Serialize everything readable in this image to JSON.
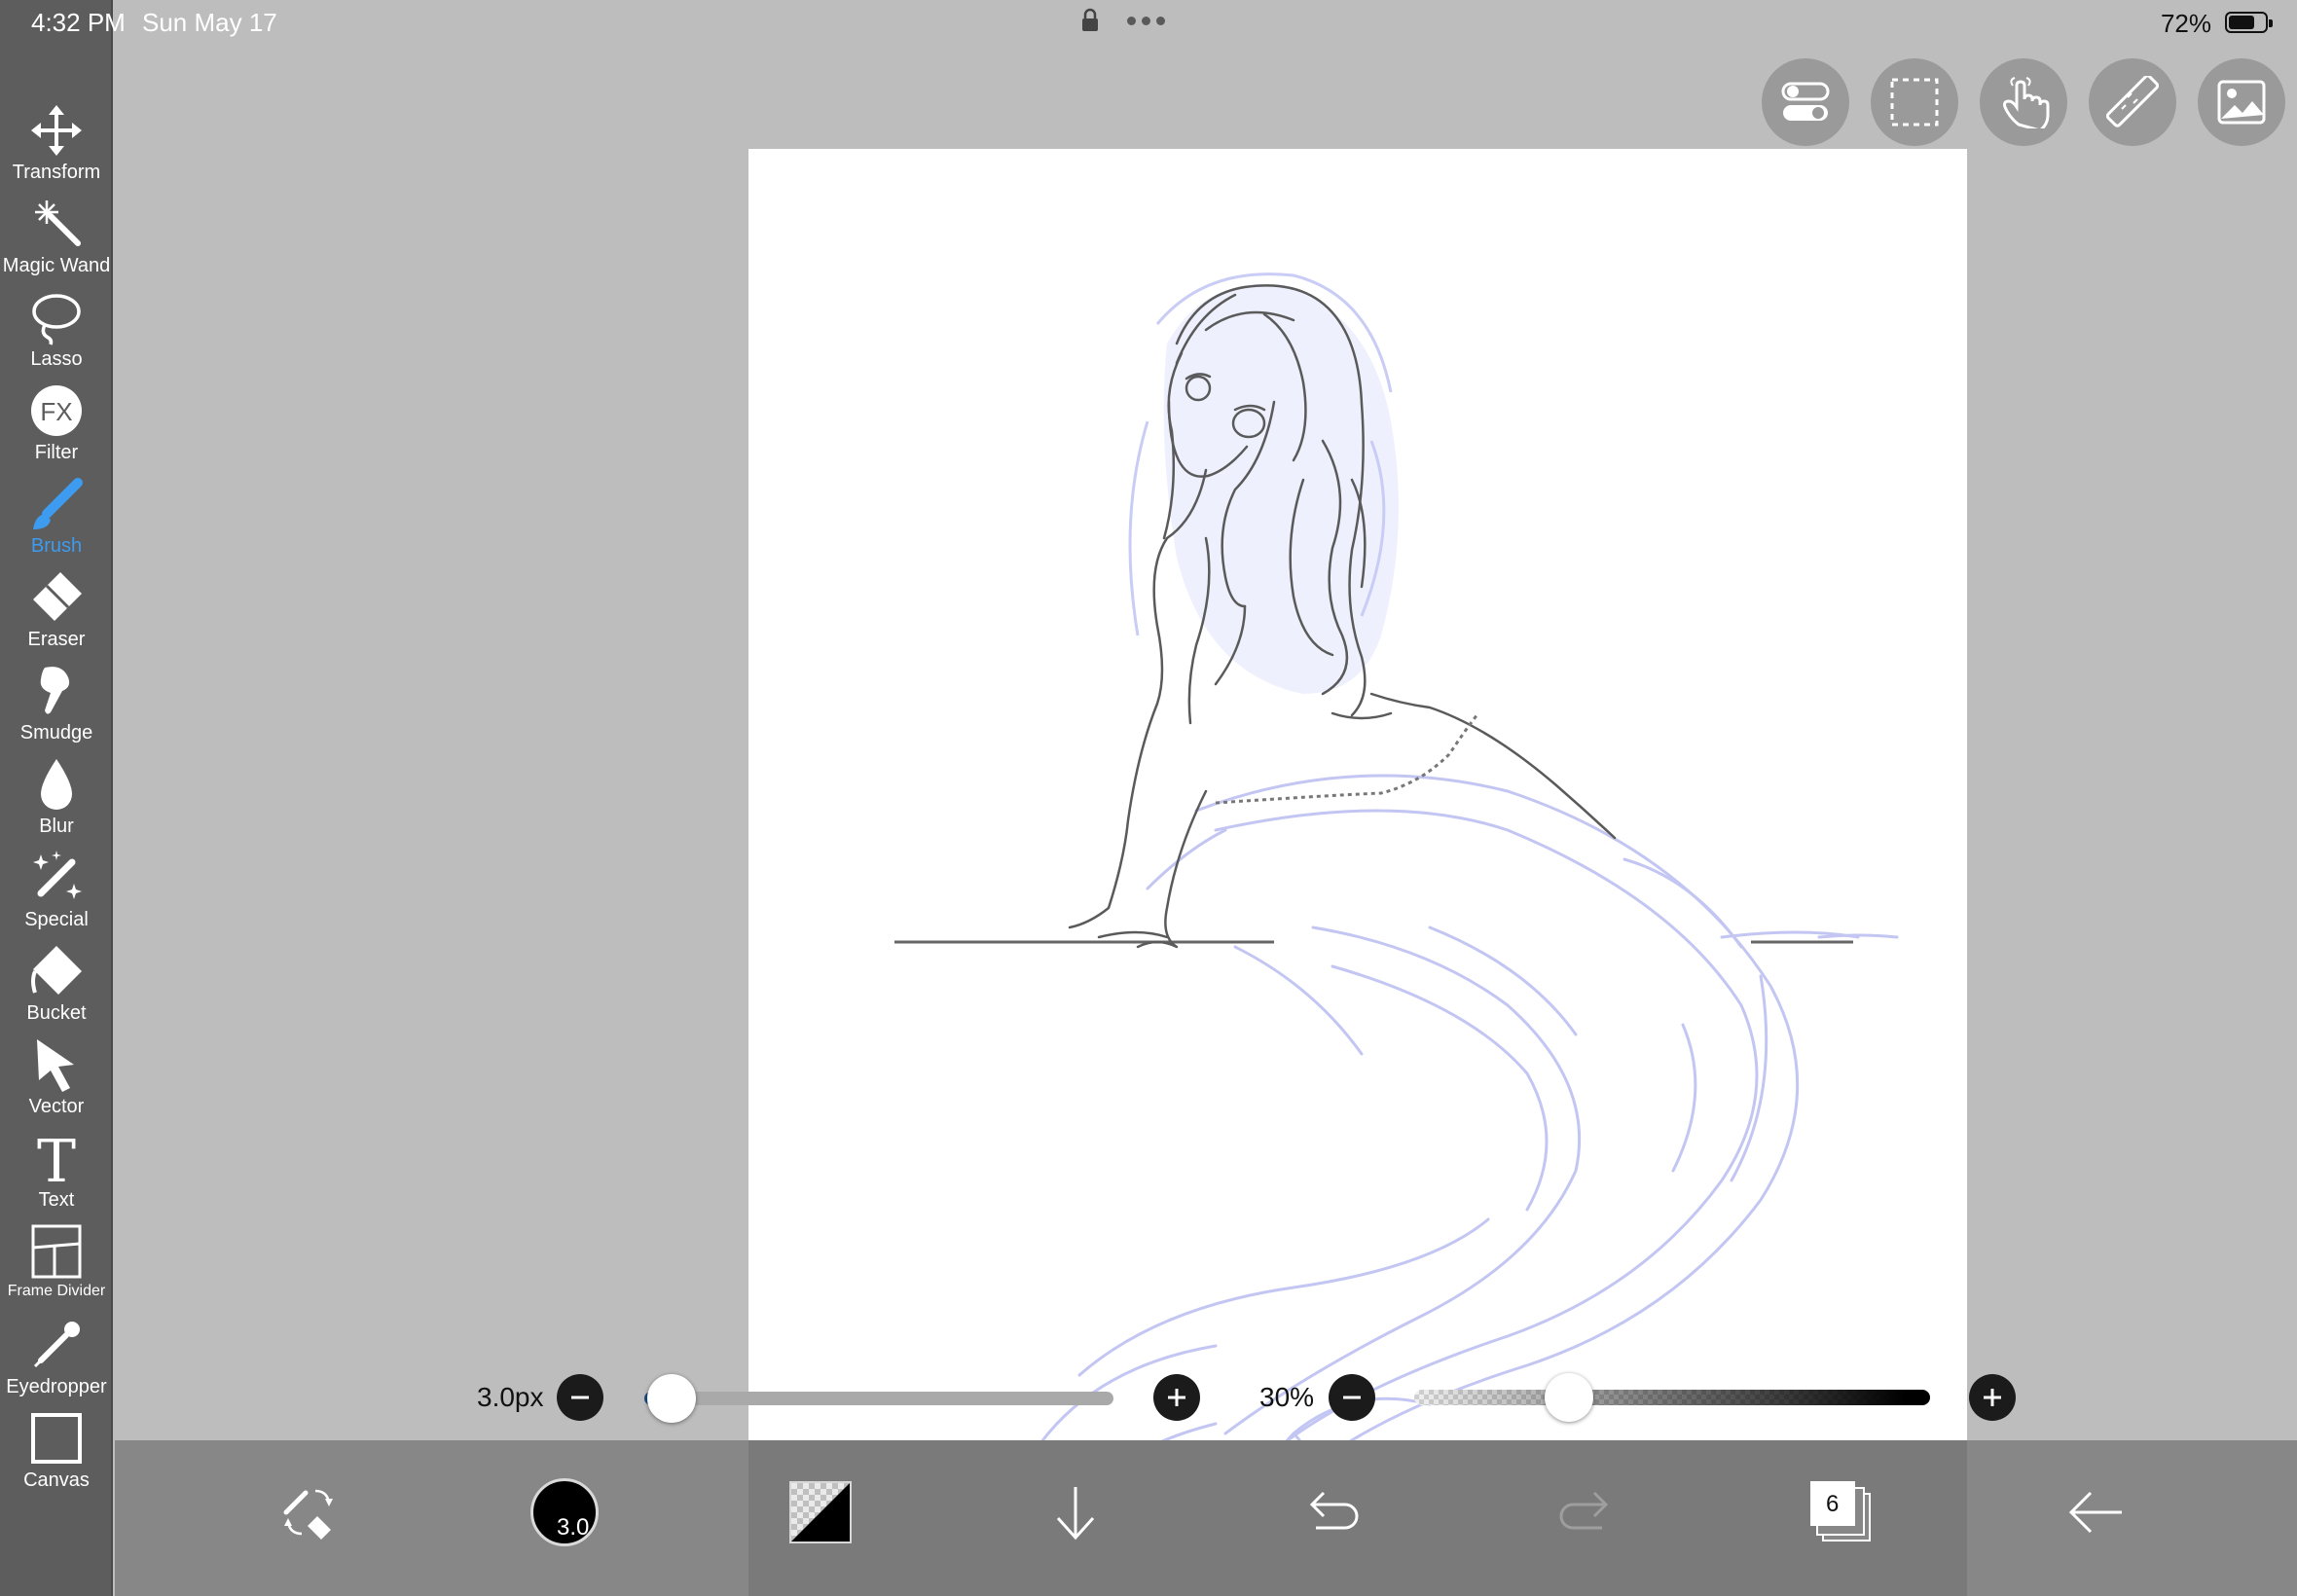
{
  "status_bar": {
    "time": "4:32 PM",
    "date": "Sun May 17",
    "battery_percent": "72%",
    "battery_level": 0.72
  },
  "tools": [
    {
      "id": "transform",
      "label": "Transform",
      "icon": "move-arrows-icon",
      "active": false
    },
    {
      "id": "magic-wand",
      "label": "Magic Wand",
      "icon": "magic-wand-icon",
      "active": false
    },
    {
      "id": "lasso",
      "label": "Lasso",
      "icon": "lasso-icon",
      "active": false
    },
    {
      "id": "filter",
      "label": "Filter",
      "icon": "fx-icon",
      "active": false
    },
    {
      "id": "brush",
      "label": "Brush",
      "icon": "brush-icon",
      "active": true
    },
    {
      "id": "eraser",
      "label": "Eraser",
      "icon": "eraser-icon",
      "active": false
    },
    {
      "id": "smudge",
      "label": "Smudge",
      "icon": "smudge-icon",
      "active": false
    },
    {
      "id": "blur",
      "label": "Blur",
      "icon": "droplet-icon",
      "active": false
    },
    {
      "id": "special",
      "label": "Special",
      "icon": "sparkle-brush-icon",
      "active": false
    },
    {
      "id": "bucket",
      "label": "Bucket",
      "icon": "bucket-icon",
      "active": false
    },
    {
      "id": "vector",
      "label": "Vector",
      "icon": "cursor-arrow-icon",
      "active": false
    },
    {
      "id": "text",
      "label": "Text",
      "icon": "text-t-icon",
      "active": false
    },
    {
      "id": "frame-divider",
      "label": "Frame Divider",
      "icon": "frame-divider-icon",
      "active": false
    },
    {
      "id": "eyedropper",
      "label": "Eyedropper",
      "icon": "eyedropper-icon",
      "active": false
    },
    {
      "id": "canvas",
      "label": "Canvas",
      "icon": "canvas-square-icon",
      "active": false
    }
  ],
  "right_buttons": [
    {
      "id": "toggle",
      "icon": "toggle-switches-icon"
    },
    {
      "id": "selection",
      "icon": "dashed-selection-icon"
    },
    {
      "id": "gesture",
      "icon": "hand-touch-icon"
    },
    {
      "id": "ruler",
      "icon": "ruler-icon"
    },
    {
      "id": "reference",
      "icon": "image-reference-icon"
    }
  ],
  "brush_size": {
    "label": "3.0px",
    "value": 3.0
  },
  "brush_opacity": {
    "label": "30%",
    "value": 0.3
  },
  "bottom_bar": {
    "brush_size_badge": "3.0",
    "layers_count": "6",
    "primary_color": "#000000",
    "icons": [
      "swap-brush-eraser-icon",
      "brush-size-icon",
      "color-swatch-icon",
      "download-arrow-icon",
      "undo-icon",
      "redo-icon",
      "layers-icon",
      "back-arrow-icon"
    ]
  },
  "colors": {
    "toolbar_bg": "#5d5d5d",
    "workspace_bg": "#bdbdbd",
    "accent": "#3d9bf0",
    "bottom_bar": "#878787",
    "sketch_line": "#555555",
    "sketch_blue": "#b9bdf2"
  }
}
